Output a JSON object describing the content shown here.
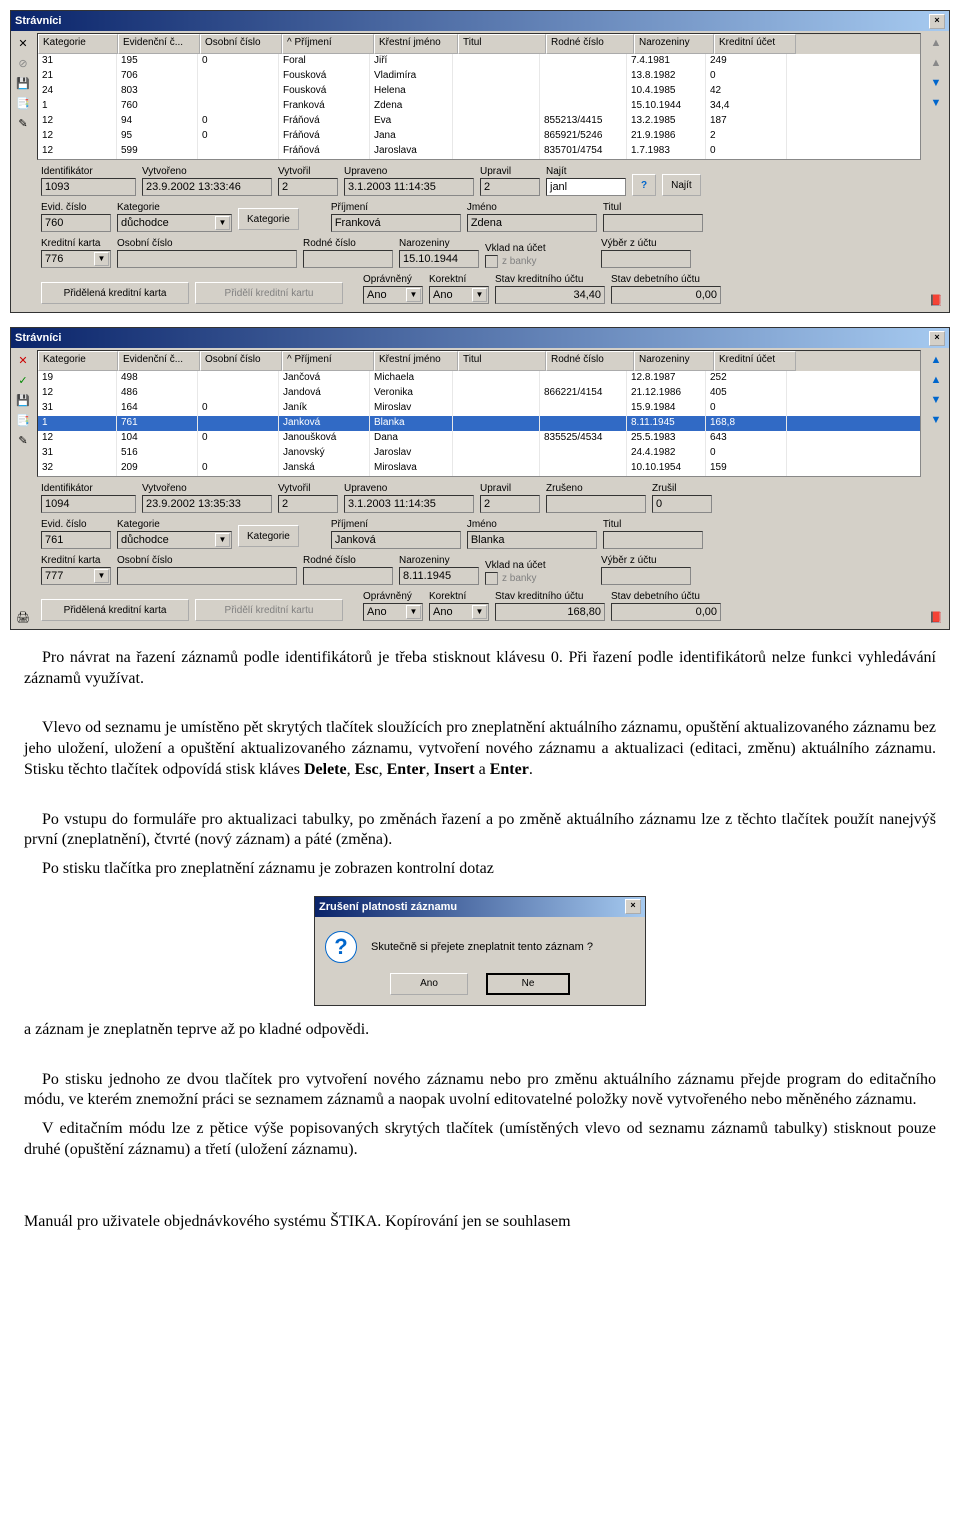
{
  "windows": {
    "w1": {
      "title": "Strávníci",
      "headers": [
        "Kategorie",
        "Evidenční č...",
        "Osobní číslo",
        "^ Příjmení",
        "Křestní jméno",
        "Titul",
        "Rodné číslo",
        "Narozeniny",
        "Kreditní účet"
      ],
      "rows": [
        [
          "31",
          "195",
          "0",
          "Foral",
          "Jiří",
          "",
          "",
          "7.4.1981",
          "249"
        ],
        [
          "21",
          "706",
          "",
          "Fousková",
          "Vladimíra",
          "",
          "",
          "13.8.1982",
          "0"
        ],
        [
          "24",
          "803",
          "",
          "Fousková",
          "Helena",
          "",
          "",
          "10.4.1985",
          "42"
        ],
        [
          "1",
          "760",
          "",
          "Franková",
          "Zdena",
          "",
          "",
          "15.10.1944",
          "34,4"
        ],
        [
          "12",
          "94",
          "0",
          "Fráňová",
          "Eva",
          "",
          "855213/4415",
          "13.2.1985",
          "187"
        ],
        [
          "12",
          "95",
          "0",
          "Fráňová",
          "Jana",
          "",
          "865921/5246",
          "21.9.1986",
          "2"
        ],
        [
          "12",
          "599",
          "",
          "Fráňová",
          "Jaroslava",
          "",
          "835701/4754",
          "1.7.1983",
          "0"
        ]
      ]
    },
    "w2": {
      "title": "Strávníci",
      "headers": [
        "Kategorie",
        "Evidenční č...",
        "Osobní číslo",
        "^ Příjmení",
        "Křestní jméno",
        "Titul",
        "Rodné číslo",
        "Narozeniny",
        "Kreditní účet"
      ],
      "rows": [
        [
          "19",
          "498",
          "",
          "Jančová",
          "Michaela",
          "",
          "",
          "12.8.1987",
          "252"
        ],
        [
          "12",
          "486",
          "",
          "Jandová",
          "Veronika",
          "",
          "866221/4154",
          "21.12.1986",
          "405"
        ],
        [
          "31",
          "164",
          "0",
          "Janík",
          "Miroslav",
          "",
          "",
          "15.9.1984",
          "0"
        ],
        [
          "1",
          "761",
          "",
          "Janková",
          "Blanka",
          "",
          "",
          "8.11.1945",
          "168,8"
        ],
        [
          "12",
          "104",
          "0",
          "Janoušková",
          "Dana",
          "",
          "835525/4534",
          "25.5.1983",
          "643"
        ],
        [
          "31",
          "516",
          "",
          "Janovský",
          "Jaroslav",
          "",
          "",
          "24.4.1982",
          "0"
        ],
        [
          "32",
          "209",
          "0",
          "Janská",
          "Miroslava",
          "",
          "",
          "10.10.1954",
          "159"
        ]
      ],
      "selected": 3
    }
  },
  "form1": {
    "ident_lbl": "Identifikátor",
    "ident": "1093",
    "vytv_lbl": "Vytvořeno",
    "vytv": "23.9.2002 13:33:46",
    "vytvoril_lbl": "Vytvořil",
    "vytvoril": "2",
    "uprav_lbl": "Upraveno",
    "uprav": "3.1.2003 11:14:35",
    "upravil_lbl": "Upravil",
    "upravil": "2",
    "najit_lbl": "Najít",
    "najit": "janl",
    "najit_btn": "Najít",
    "evid_lbl": "Evid. číslo",
    "evid": "760",
    "kat_lbl": "Kategorie",
    "kat": "důchodce",
    "kat_btn": "Kategorie",
    "prij_lbl": "Příjmení",
    "prij": "Franková",
    "jmeno_lbl": "Jméno",
    "jmeno": "Zdena",
    "titul_lbl": "Titul",
    "titul": "",
    "kk_lbl": "Kreditní karta",
    "kk": "776",
    "oscis_lbl": "Osobní číslo",
    "oscis": "",
    "rc_lbl": "Rodné číslo",
    "rc": "",
    "nar_lbl": "Narozeniny",
    "nar": "15.10.1944",
    "vklad_lbl": "Vklad na účet",
    "zbanky": "z banky",
    "vyber_lbl": "Výběr z účtu",
    "vyber": "",
    "pkk_btn": "Přidělená kreditní karta",
    "pkk2_btn": "Přidělí kreditní kartu",
    "opr_lbl": "Oprávněný",
    "opr": "Ano",
    "kor_lbl": "Korektní",
    "kor": "Ano",
    "sku_lbl": "Stav kreditního účtu",
    "sku": "34,40",
    "sdu_lbl": "Stav debetního účtu",
    "sdu": "0,00"
  },
  "form2": {
    "ident_lbl": "Identifikátor",
    "ident": "1094",
    "vytv_lbl": "Vytvořeno",
    "vytv": "23.9.2002 13:35:33",
    "vytvoril_lbl": "Vytvořil",
    "vytvoril": "2",
    "uprav_lbl": "Upraveno",
    "uprav": "3.1.2003 11:14:35",
    "upravil_lbl": "Upravil",
    "upravil": "2",
    "zrus_lbl": "Zrušeno",
    "zrus": "",
    "zrusil_lbl": "Zrušil",
    "zrusil": "0",
    "evid_lbl": "Evid. číslo",
    "evid": "761",
    "kat_lbl": "Kategorie",
    "kat": "důchodce",
    "kat_btn": "Kategorie",
    "prij_lbl": "Příjmení",
    "prij": "Janková",
    "jmeno_lbl": "Jméno",
    "jmeno": "Blanka",
    "titul_lbl": "Titul",
    "titul": "",
    "kk_lbl": "Kreditní karta",
    "kk": "777",
    "oscis_lbl": "Osobní číslo",
    "oscis": "",
    "rc_lbl": "Rodné číslo",
    "rc": "",
    "nar_lbl": "Narozeniny",
    "nar": "8.11.1945",
    "vklad_lbl": "Vklad na účet",
    "zbanky": "z banky",
    "vyber_lbl": "Výběr z účtu",
    "vyber": "",
    "pkk_btn": "Přidělená kreditní karta",
    "pkk2_btn": "Přidělí kreditní kartu",
    "opr_lbl": "Oprávněný",
    "opr": "Ano",
    "kor_lbl": "Korektní",
    "kor": "Ano",
    "sku_lbl": "Stav kreditního účtu",
    "sku": "168,80",
    "sdu_lbl": "Stav debetního účtu",
    "sdu": "0,00"
  },
  "prose": {
    "p1": "Pro návrat na řazení záznamů podle identifikátorů je třeba stisknout klávesu 0. Při řazení podle identifikátorů nelze funkci vyhledávání záznamů využívat.",
    "p2": "Vlevo od seznamu je umístěno pět skrytých tlačítek sloužících pro zneplatnění aktuálního záznamu, opuštění aktualizovaného záznamu bez jeho uložení, uložení a opuštění aktualizovaného záznamu, vytvoření nového záznamu a aktualizaci (editaci, změnu) aktuálního záznamu. Stisku těchto tlačítek odpovídá stisk kláves ",
    "p2b": "Delete",
    "p2c": ", ",
    "p2d": "Esc",
    "p2e": ", ",
    "p2f": "Enter",
    "p2g": ", ",
    "p2h": "Insert",
    "p2i": " a ",
    "p2j": "Enter",
    "p2k": ".",
    "p3": "Po vstupu do formuláře pro aktualizaci tabulky, po změnách řazení a po změně aktuálního záznamu lze z těchto tlačítek použít nanejvýš první (zneplatnění), čtvrté (nový záznam) a páté (změna).",
    "p4": "Po stisku tlačítka pro zneplatnění záznamu je zobrazen kontrolní dotaz",
    "p5": "a záznam je zneplatněn teprve až po kladné odpovědi.",
    "p6": "Po stisku jednoho ze dvou  tlačítek pro vytvoření nového záznamu nebo pro změnu aktuálního záznamu přejde program do editačního módu, ve kterém znemožní práci se seznamem záznamů a naopak uvolní editovatelné položky nově vytvořeného nebo měněného záznamu.",
    "p7": "V editačním módu lze z pětice výše popisovaných skrytých tlačítek (umístěných vlevo od seznamu záznamů tabulky) stisknout pouze druhé (opuštění záznamu) a třetí (uložení záznamu)."
  },
  "dialog": {
    "title": "Zrušení platnosti záznamu",
    "text": "Skutečně si přejete zneplatnit tento záznam ?",
    "yes": "Ano",
    "no": "Ne"
  },
  "footer": "Manuál pro uživatele objednávkového systému ŠTIKA. Kopírování jen se souhlasem"
}
